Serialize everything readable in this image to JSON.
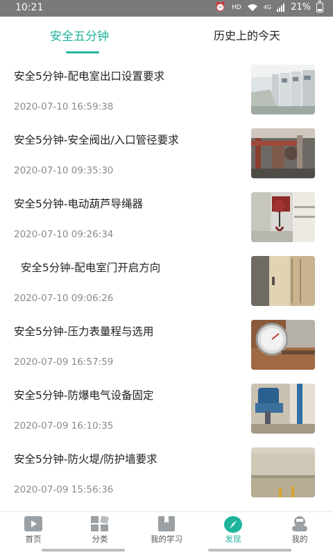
{
  "status_bar": {
    "time": "10:21",
    "network": "HD",
    "signal": "4G",
    "battery": "21%"
  },
  "tabs": [
    {
      "label": "安全五分钟",
      "active": true
    },
    {
      "label": "历史上的今天",
      "active": false
    }
  ],
  "articles": [
    {
      "title": "安全5分钟-配电室出口设置要求",
      "date": "2020-07-10 16:59:38"
    },
    {
      "title": "安全5分钟-安全阀出/入口管径要求",
      "date": "2020-07-10 09:35:30"
    },
    {
      "title": "安全5分钟-电动葫芦导绳器",
      "date": "2020-07-10 09:26:34"
    },
    {
      "title": "  安全5分钟-配电室门开启方向",
      "date": "2020-07-10 09:06:26"
    },
    {
      "title": "安全5分钟-压力表量程与选用",
      "date": "2020-07-09 16:57:59"
    },
    {
      "title": "安全5分钟-防爆电气设备固定",
      "date": "2020-07-09 16:10:35"
    },
    {
      "title": "安全5分钟-防火堤/防护墙要求",
      "date": "2020-07-09 15:56:36"
    }
  ],
  "bottom_nav": [
    {
      "label": "首页",
      "icon": "play-icon"
    },
    {
      "label": "分类",
      "icon": "category-icon"
    },
    {
      "label": "我的学习",
      "icon": "bookmark-icon"
    },
    {
      "label": "发现",
      "icon": "compass-icon",
      "active": true
    },
    {
      "label": "我的",
      "icon": "profile-icon"
    }
  ],
  "colors": {
    "accent": "#1fb39c",
    "status_bar": "#7a7a7a",
    "muted": "#8a8a8a"
  }
}
